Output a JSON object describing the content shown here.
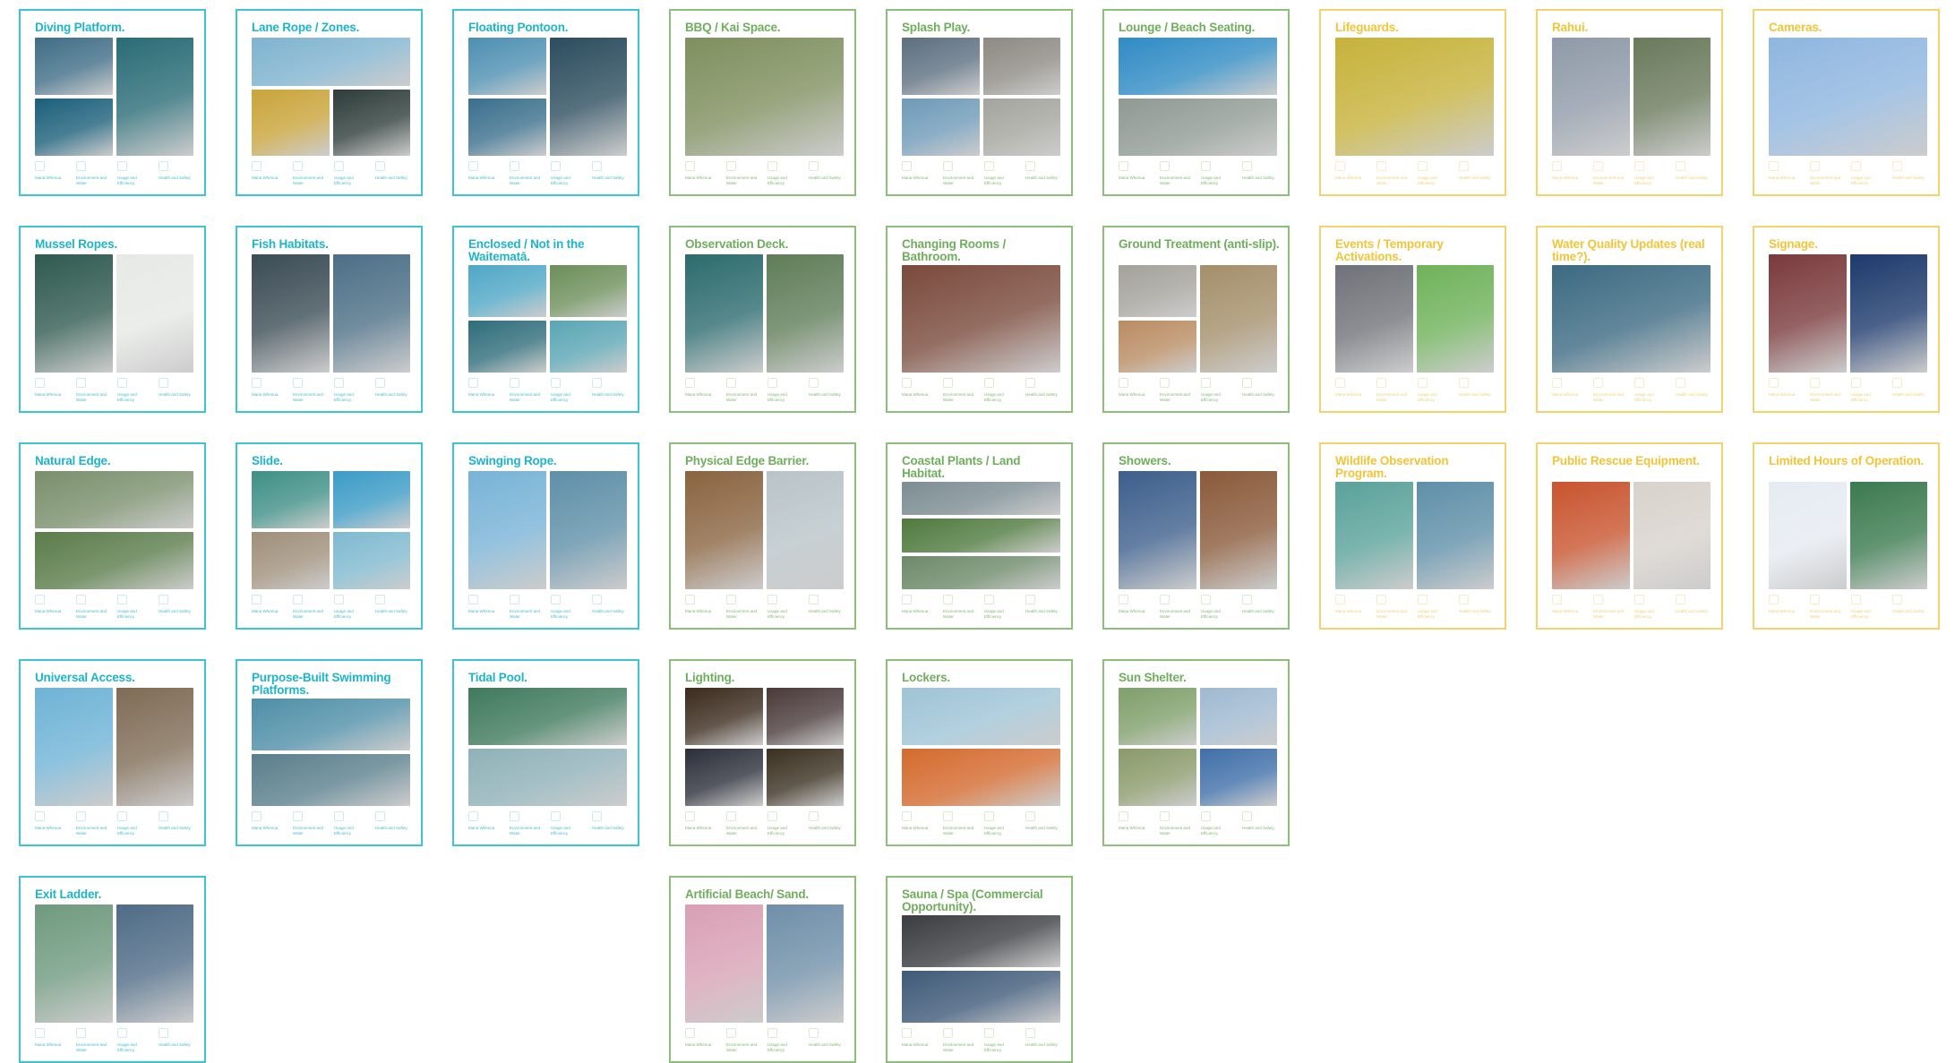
{
  "criteria_labels": [
    "Mana Whenua",
    "Environment and Water",
    "Usage and Efficiency",
    "Health and Safety"
  ],
  "cards": [
    {
      "title": "Diving Platform.",
      "theme": "teal",
      "layout": "quad-tall-right",
      "colors": [
        "#3f6d86",
        "#1b5f7a",
        "#2a6c76",
        "#6a8fa0"
      ]
    },
    {
      "title": "Lane Rope / Zones.",
      "theme": "teal",
      "layout": "top-wide",
      "colors": [
        "#7fb3cf",
        "#c9a43a",
        "#2e3d3a"
      ]
    },
    {
      "title": "Floating Pontoon.",
      "theme": "teal",
      "layout": "quad-tall-right",
      "colors": [
        "#4d8fb1",
        "#3a6f8c",
        "#2c4d5e",
        "#6aa0bd"
      ]
    },
    {
      "title": "BBQ / Kai Space.",
      "theme": "green",
      "layout": "single",
      "colors": [
        "#7f8f5e"
      ]
    },
    {
      "title": "Splash Play.",
      "theme": "green",
      "layout": "quad",
      "colors": [
        "#5d6f80",
        "#8d8a83",
        "#6f9ab8",
        "#a4a49e"
      ]
    },
    {
      "title": "Lounge / Beach Seating.",
      "theme": "green",
      "layout": "stack",
      "colors": [
        "#2f8bc4",
        "#8f9a93"
      ]
    },
    {
      "title": "Lifeguards.",
      "theme": "yellow",
      "layout": "single",
      "colors": [
        "#c6b23a"
      ]
    },
    {
      "title": "Rahui.",
      "theme": "yellow",
      "layout": "side",
      "colors": [
        "#8f9aa8",
        "#6a7a5c"
      ]
    },
    {
      "title": "Cameras.",
      "theme": "yellow",
      "layout": "single",
      "colors": [
        "#8fb6df"
      ]
    },
    {
      "title": "Mussel Ropes.",
      "theme": "teal",
      "layout": "side",
      "colors": [
        "#2f5a4f",
        "#e6e9e6"
      ]
    },
    {
      "title": "Fish Habitats.",
      "theme": "teal",
      "layout": "side",
      "colors": [
        "#3b4c55",
        "#4c6f86"
      ]
    },
    {
      "title": "Enclosed / Not in the Waitematā.",
      "theme": "teal",
      "layout": "quad",
      "colors": [
        "#4fa7c6",
        "#6c8f5a",
        "#2f6d7a",
        "#5aa6b4"
      ],
      "two_line": true
    },
    {
      "title": "Observation Deck.",
      "theme": "green",
      "layout": "side",
      "colors": [
        "#2c6b6e",
        "#5f7d58"
      ]
    },
    {
      "title": "Changing Rooms / Bathroom.",
      "theme": "green",
      "layout": "single",
      "colors": [
        "#7a4a3c"
      ],
      "two_line": true
    },
    {
      "title": "Ground Treatment (anti-slip).",
      "theme": "green",
      "layout": "quad-tall-right",
      "colors": [
        "#a3a19a",
        "#b98c62",
        "#a48f6a",
        "#b98c62"
      ],
      "two_line": true
    },
    {
      "title": "Events / Temporary Activations.",
      "theme": "yellow",
      "layout": "side",
      "colors": [
        "#6f7278",
        "#6fb25a"
      ],
      "two_line": true
    },
    {
      "title": "Water Quality Updates (real time?).",
      "theme": "yellow",
      "layout": "single",
      "colors": [
        "#3c6a82"
      ],
      "two_line": true
    },
    {
      "title": "Signage.",
      "theme": "yellow",
      "layout": "side",
      "colors": [
        "#7a3a3c",
        "#1d3a6c"
      ]
    },
    {
      "title": "Natural Edge.",
      "theme": "teal",
      "layout": "stack",
      "colors": [
        "#7a8f6c",
        "#5a7c4a"
      ]
    },
    {
      "title": "Slide.",
      "theme": "teal",
      "layout": "quad",
      "colors": [
        "#3e8f86",
        "#3b9bc6",
        "#9f8f7a",
        "#7fb9cf"
      ]
    },
    {
      "title": "Swinging Rope.",
      "theme": "teal",
      "layout": "side",
      "colors": [
        "#78b3d6",
        "#5f8fa8"
      ]
    },
    {
      "title": "Physical Edge Barrier.",
      "theme": "green",
      "layout": "side",
      "colors": [
        "#8a6440",
        "#b9c4c8"
      ]
    },
    {
      "title": "Coastal Plants / Land Habitat.",
      "theme": "green",
      "layout": "stack3",
      "colors": [
        "#7c8d93",
        "#4f7a3e",
        "#6d8a6a"
      ],
      "two_line": true
    },
    {
      "title": "Showers.",
      "theme": "green",
      "layout": "side",
      "colors": [
        "#3d5f8c",
        "#8a5a3a"
      ]
    },
    {
      "title": "Wildlife Observation Program.",
      "theme": "yellow",
      "layout": "side",
      "colors": [
        "#5aa29a",
        "#5f8fa8"
      ],
      "two_line": true
    },
    {
      "title": "Public Rescue Equipment.",
      "theme": "yellow",
      "layout": "side",
      "colors": [
        "#c8542e",
        "#d8d2cc"
      ],
      "two_line": true
    },
    {
      "title": "Limited Hours of Operation.",
      "theme": "yellow",
      "layout": "side",
      "colors": [
        "#e6ebf2",
        "#3b7a4f"
      ],
      "two_line": true
    },
    {
      "title": "Universal Access.",
      "theme": "teal",
      "layout": "side",
      "colors": [
        "#6fb3d6",
        "#7f6c56"
      ]
    },
    {
      "title": "Purpose-Built Swimming Platforms.",
      "theme": "teal",
      "layout": "stack",
      "colors": [
        "#4f8fa8",
        "#5a7f8c"
      ],
      "two_line": true
    },
    {
      "title": "Tidal Pool.",
      "theme": "teal",
      "layout": "stack",
      "colors": [
        "#3f7a5c",
        "#8fb1b8"
      ]
    },
    {
      "title": "Lighting.",
      "theme": "green",
      "layout": "quad",
      "colors": [
        "#3a2a1c",
        "#4a3a3a",
        "#2c2f3a",
        "#3a3020"
      ]
    },
    {
      "title": "Lockers.",
      "theme": "green",
      "layout": "stack",
      "colors": [
        "#9fc4d6",
        "#d46a2e"
      ]
    },
    {
      "title": "Sun Shelter.",
      "theme": "green",
      "layout": "quad",
      "colors": [
        "#7f9f6a",
        "#9fb9d0",
        "#8a9a6a",
        "#3f6fa8"
      ]
    },
    {
      "title": "Exit Ladder.",
      "theme": "teal",
      "layout": "side",
      "colors": [
        "#6f9a7f",
        "#4f6c86"
      ]
    },
    {
      "title": "Artificial Beach/ Sand.",
      "theme": "green",
      "layout": "side",
      "colors": [
        "#d8a0b4",
        "#6f8fa8"
      ]
    },
    {
      "title": "Sauna / Spa (Commercial Opportunity).",
      "theme": "green",
      "layout": "stack",
      "colors": [
        "#3a3c40",
        "#3f5a78"
      ],
      "two_line": true
    }
  ]
}
